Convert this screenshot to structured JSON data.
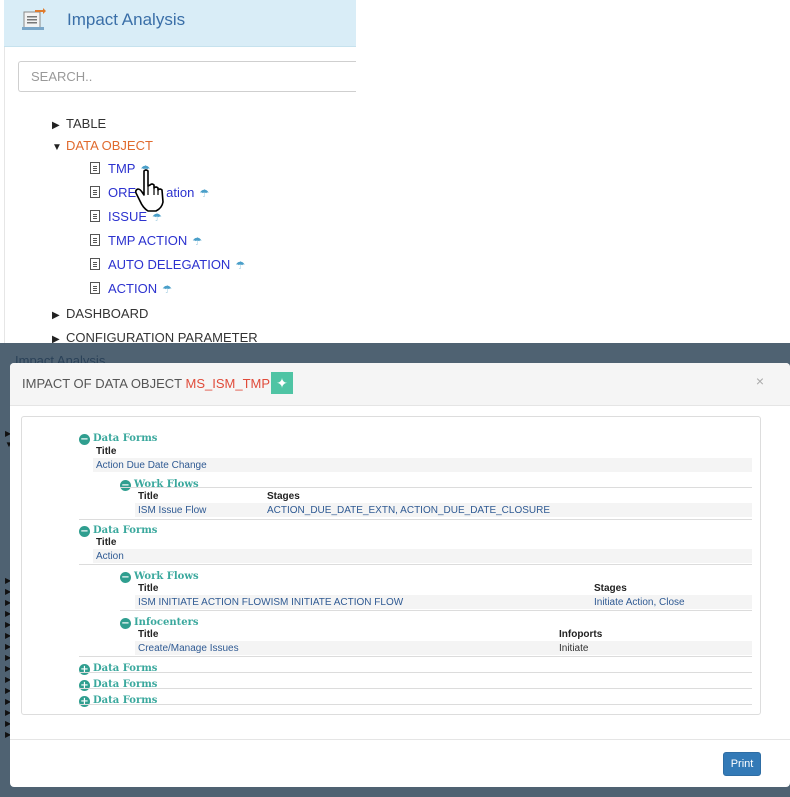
{
  "app": {
    "title": "Impact Analysis",
    "search_placeholder": "SEARCH.."
  },
  "tree": {
    "table_label": "TABLE",
    "data_object_label": "DATA OBJECT",
    "data_object_items": [
      "TMP",
      "ORE",
      "ation",
      "ISSUE",
      "TMP ACTION",
      "AUTO DELEGATION",
      "ACTION"
    ],
    "dashboard_label": "DASHBOARD",
    "config_label": "CONFIGURATION PARAMETER"
  },
  "background": {
    "title": "Impact Analysis"
  },
  "modal": {
    "title_prefix": "IMPACT OF DATA OBJECT",
    "object_name": "MS_ISM_TMP",
    "close_symbol": "×",
    "print_label": "Print"
  },
  "sections": {
    "data_forms_label": "Data Forms",
    "work_flows_label": "Work Flows",
    "infocenters_label": "Infocenters",
    "title_header": "Title",
    "stages_header": "Stages",
    "infoports_header": "Infoports",
    "df1_title": "Action Due Date Change",
    "df1_wf_title": "ISM Issue Flow",
    "df1_wf_stages": "ACTION_DUE_DATE_EXTN, ACTION_DUE_DATE_CLOSURE",
    "df2_title": "Action",
    "df2_wf_title": "ISM INITIATE ACTION FLOWISM INITIATE ACTION FLOW",
    "df2_wf_stages": "Initiate Action, Close",
    "df2_ic_title": "Create/Manage Issues",
    "df2_ic_infoports": "Initiate"
  },
  "colors": {
    "header_bg": "#d9edf7",
    "accent_link": "#2c32cf",
    "open_node": "#e06a2d",
    "section_title": "#3aa89d",
    "object_name": "#e04b3a",
    "print_button": "#337ab7"
  }
}
